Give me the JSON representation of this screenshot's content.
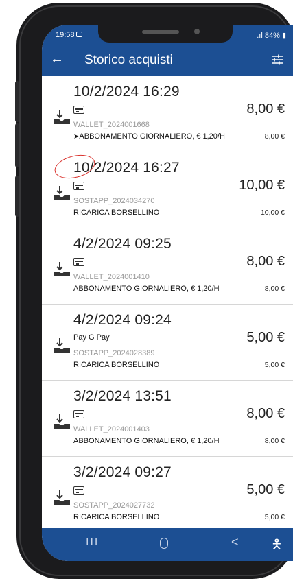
{
  "status": {
    "time": "19:58",
    "battery": "84%",
    "signal": ".ıl"
  },
  "appbar": {
    "back_icon": "arrow-left-icon",
    "title": "Storico acquisti",
    "filter_icon": "filter-sliders-icon"
  },
  "colors": {
    "primary": "#1c4f93",
    "annotation": "#d9302b"
  },
  "purchases": [
    {
      "date": "10/2/2024  16:29",
      "amount": "8,00 €",
      "payment": "card-icon",
      "ref": "WALLET_2024001668",
      "arrow": "➤",
      "desc": "ABBONAMENTO GIORNALIERO, € 1,20/H",
      "desc_amount": "8,00 €"
    },
    {
      "date": "10/2/2024  16:27",
      "amount": "10,00 €",
      "payment": "card-icon",
      "ref": "SOSTAPP_2024034270",
      "desc": "RICARICA BORSELLINO",
      "desc_amount": "10,00 €"
    },
    {
      "date": "4/2/2024  09:25",
      "amount": "8,00 €",
      "payment": "card-icon",
      "ref": "WALLET_2024001410",
      "desc": "ABBONAMENTO GIORNALIERO, € 1,20/H",
      "desc_amount": "8,00 €"
    },
    {
      "date": "4/2/2024  09:24",
      "amount": "5,00 €",
      "payment_text": " Pay  G Pay",
      "ref": "SOSTAPP_2024028389",
      "desc": "RICARICA BORSELLINO",
      "desc_amount": "5,00 €"
    },
    {
      "date": "3/2/2024  13:51",
      "amount": "8,00 €",
      "payment": "card-icon",
      "ref": "WALLET_2024001403",
      "desc": "ABBONAMENTO GIORNALIERO, € 1,20/H",
      "desc_amount": "8,00 €"
    },
    {
      "date": "3/2/2024  09:27",
      "amount": "5,00 €",
      "payment": "card-icon",
      "ref": "SOSTAPP_2024027732",
      "desc": "RICARICA BORSELLINO",
      "desc_amount": "5,00 €"
    }
  ],
  "navbar": {
    "recent": "III",
    "back": "<",
    "accessibility_icon": "accessibility-icon"
  }
}
